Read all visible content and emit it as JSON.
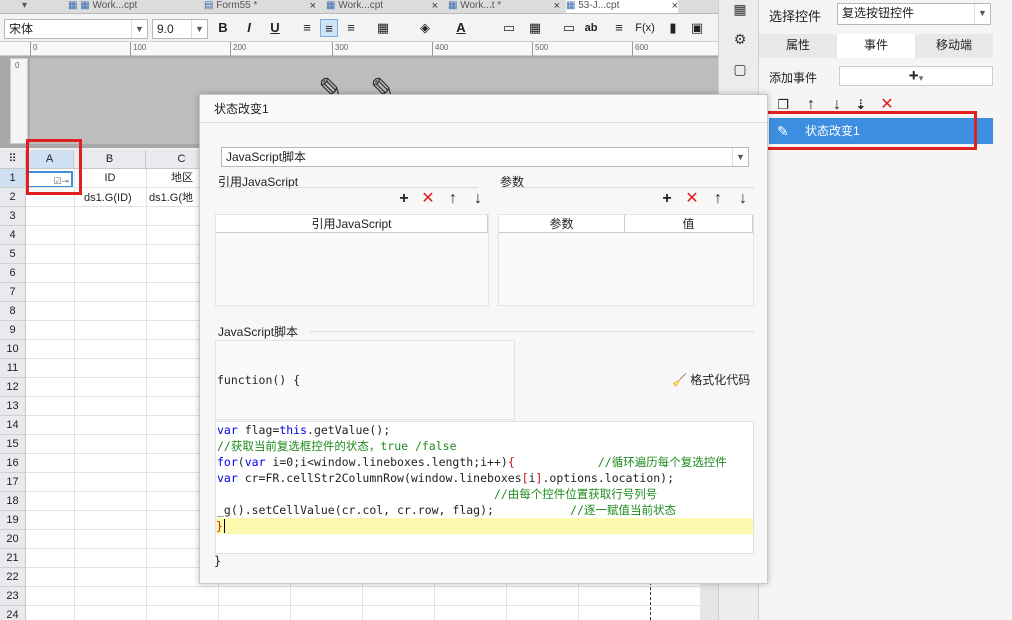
{
  "tabs": [
    {
      "label": "Work...cpt"
    },
    {
      "label": "Form55 *"
    },
    {
      "label": "Work...cpt"
    },
    {
      "label": "Work...t *"
    },
    {
      "label": "53-J...cpt"
    }
  ],
  "toolbar": {
    "font": "宋体",
    "size": "9.0",
    "bold": "B",
    "italic": "I",
    "underline": "U",
    "text_glyph": "ab",
    "fx": "F(x)"
  },
  "ruler": {
    "ticks": [
      "0",
      "100",
      "200",
      "300",
      "400",
      "500",
      "600"
    ]
  },
  "vruler_label": "0",
  "grid": {
    "columns": [
      "A",
      "B",
      "C"
    ],
    "rows": [
      "1",
      "2",
      "3",
      "4",
      "5",
      "6",
      "7",
      "8",
      "9",
      "10",
      "11",
      "12",
      "13",
      "14",
      "15",
      "16",
      "17",
      "18",
      "19",
      "20",
      "21",
      "22",
      "23",
      "24"
    ],
    "cells": {
      "b1": "ID",
      "c1": "地区",
      "b2": "ds1.G(ID)",
      "c2": "ds1.G(地"
    }
  },
  "right_panel": {
    "select_label": "选择控件",
    "select_value": "复选按钮控件",
    "tabs": [
      "属性",
      "事件",
      "移动端"
    ],
    "active_tab": "事件",
    "add_event_label": "添加事件",
    "add_event_button": "+",
    "event_item": "状态改变1"
  },
  "dialog": {
    "title": "状态改变1",
    "type_select": "JavaScript脚本",
    "ref_js_label": "引用JavaScript",
    "params_label": "参数",
    "ref_js_col": "引用JavaScript",
    "param_col": "参数",
    "value_col": "值",
    "script_label": "JavaScript脚本",
    "function_header": "function() {",
    "format_button": "格式化代码",
    "closing_brace": "}",
    "code": [
      "var flag=this.getValue();",
      "//获取当前复选框控件的状态，true /false",
      "for(var i=0;i<window.lineboxes.length;i++){            //循环遍历每个复选控件",
      "var cr=FR.cellStr2ColumnRow(window.lineboxes[i].options.location);",
      "                                        //由每个控件位置获取行号列号",
      "_g().setCellValue(cr.col, cr.row, flag);           //逐一赋值当前状态",
      "}"
    ]
  },
  "colors": {
    "accent": "#3d8ee0",
    "highlight_box": "#e02020",
    "code_highlight": "#fdfab0"
  }
}
